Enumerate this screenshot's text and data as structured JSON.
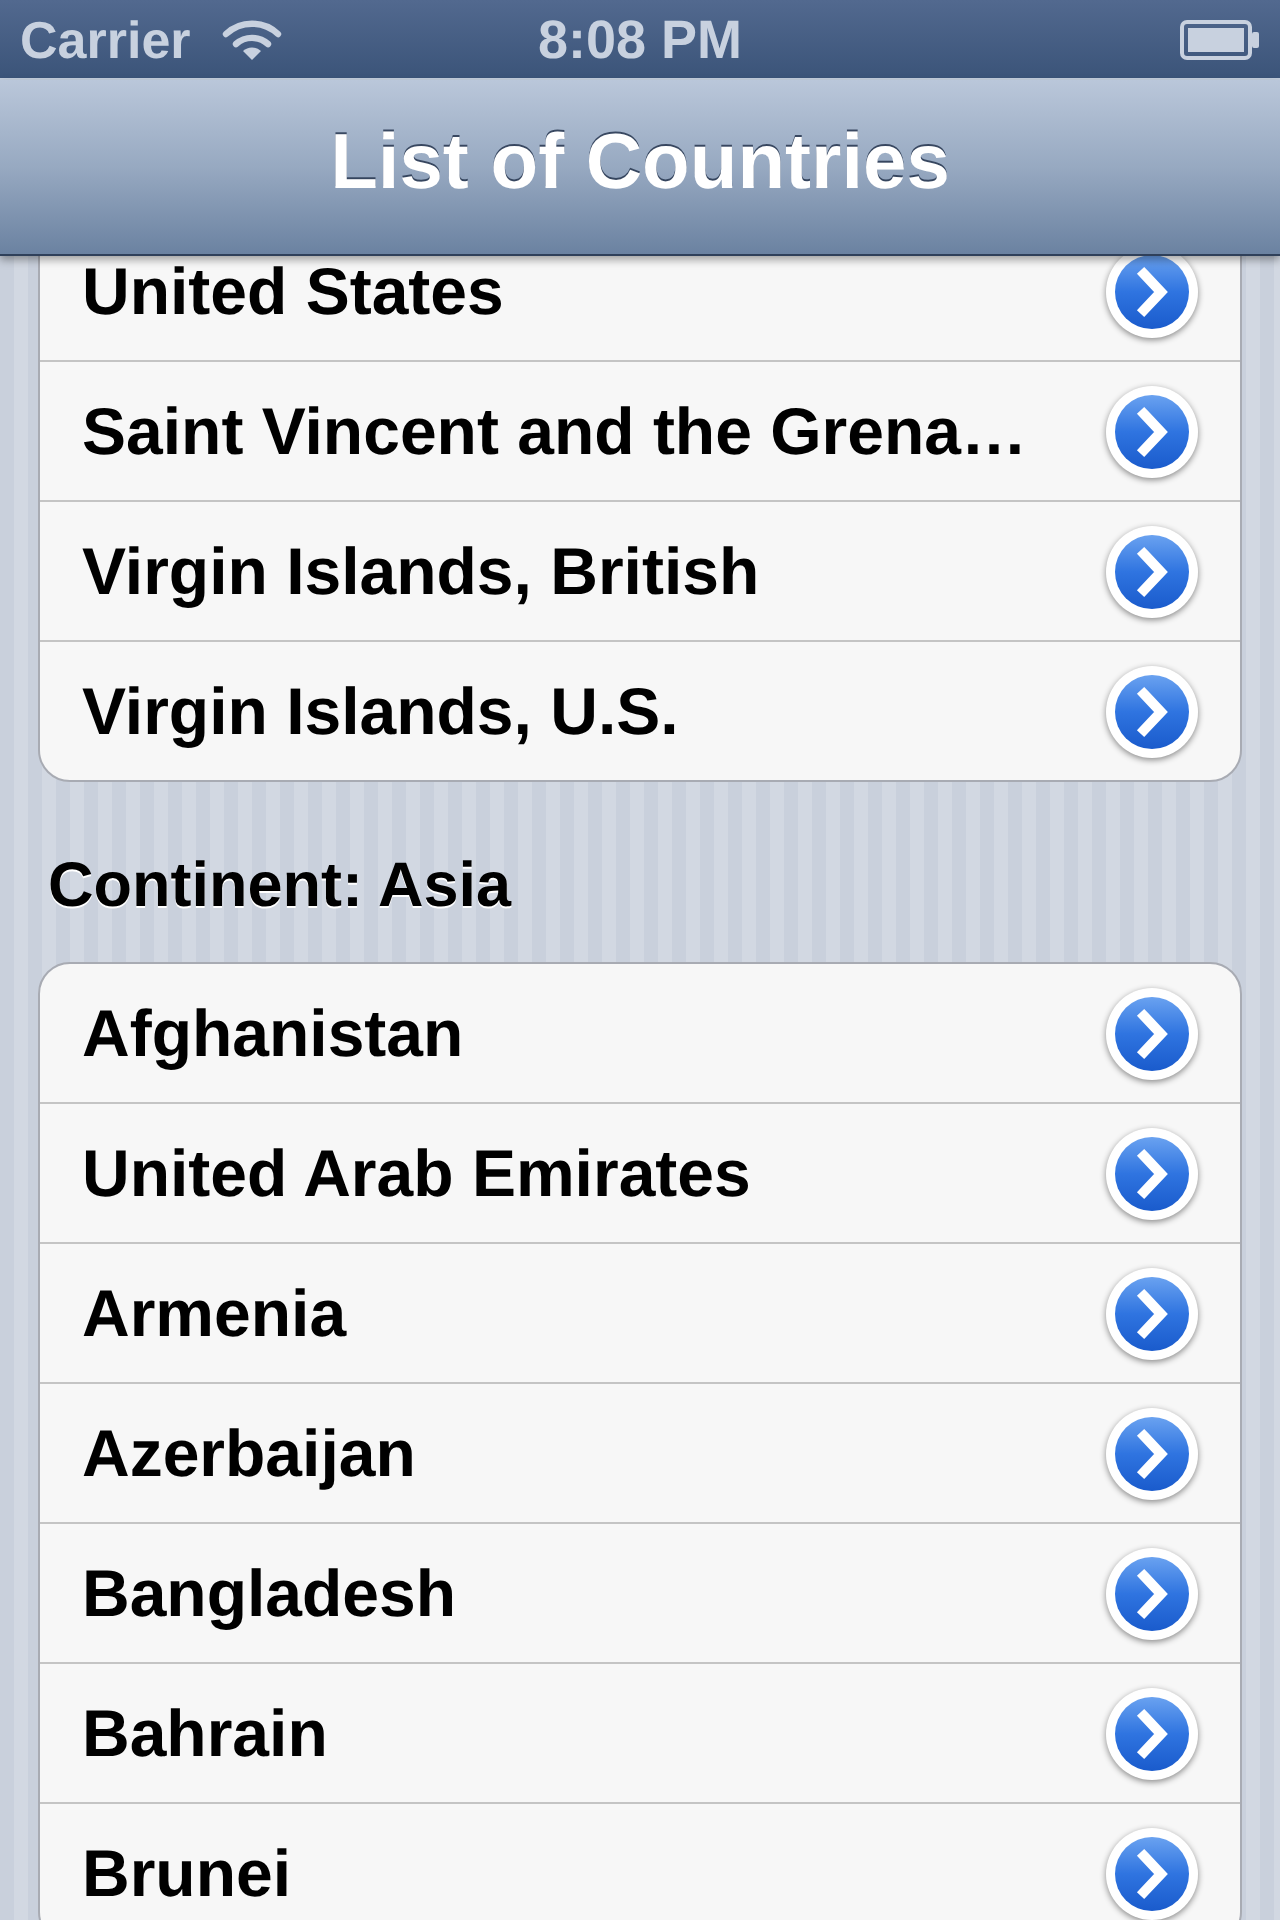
{
  "status_bar": {
    "carrier": "Carrier",
    "time": "8:08 PM"
  },
  "nav_bar": {
    "title": "List of Countries"
  },
  "sections": [
    {
      "rows": [
        {
          "name": "United States"
        },
        {
          "name": "Saint Vincent and the Grena…"
        },
        {
          "name": "Virgin Islands, British"
        },
        {
          "name": "Virgin Islands, U.S."
        }
      ]
    },
    {
      "header": "Continent: Asia",
      "rows": [
        {
          "name": "Afghanistan"
        },
        {
          "name": "United Arab Emirates"
        },
        {
          "name": "Armenia"
        },
        {
          "name": "Azerbaijan"
        },
        {
          "name": "Bangladesh"
        },
        {
          "name": "Bahrain"
        },
        {
          "name": "Brunei"
        }
      ]
    }
  ]
}
